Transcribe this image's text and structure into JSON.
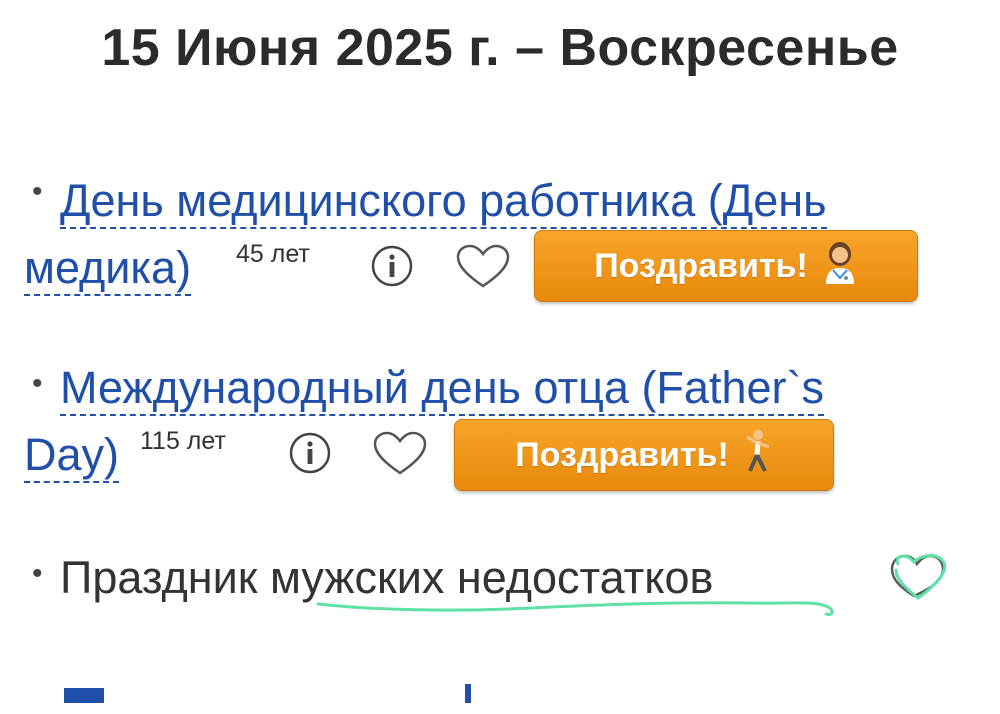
{
  "header": {
    "title": "15 Июня 2025 г. – Воскресенье"
  },
  "holidays": [
    {
      "line1": "День медицинского работника (День",
      "line2": "медика)",
      "years": "45 лет",
      "button_label": "Поздравить!",
      "button_icon": "doctor-emoji-icon"
    },
    {
      "line1": "Международный день отца (Father`s",
      "line2": "Day)",
      "years": "115 лет",
      "button_label": "Поздравить!",
      "button_icon": "dancing-man-emoji-icon"
    },
    {
      "text_part1": "Праздник ",
      "text_part2": "мужских недостатков",
      "heart_state": "green-hand-drawn-heart"
    }
  ],
  "colors": {
    "link": "#1f4fa8",
    "button": "#f39a1e",
    "annotation": "#5ee0a6"
  },
  "bullet": "•"
}
